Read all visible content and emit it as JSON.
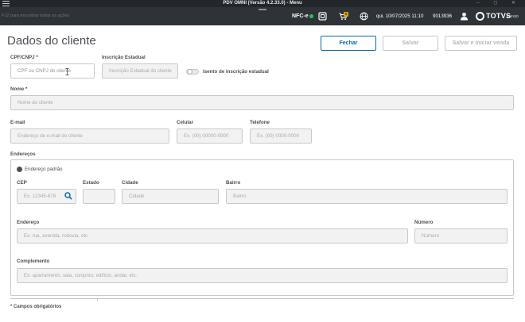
{
  "window": {
    "title": "PDV OMNI (Versão 4.2.33.0) - Menu",
    "controls": "–  ◻  ✕"
  },
  "header": {
    "hint": "F12 para encontrar todas as ações",
    "nfce_label": "NFC-e",
    "cart_badge": "0",
    "datetime": "qui. 10/07/2025 11:10",
    "store_code": "9013936",
    "brand": "TOTVS",
    "brand_sub": "varejo"
  },
  "page": {
    "title": "Dados do cliente"
  },
  "actions": {
    "close": "Fechar",
    "save": "Salvar",
    "save_and_sell": "Salvar e iniciar venda"
  },
  "form": {
    "cpf_label": "CPF/CNPJ *",
    "cpf_placeholder": "CPF ou CNPJ do cliente",
    "ie_label": "Inscrição Estadual",
    "ie_placeholder": "Inscrição Estadual do cliente",
    "ie_exempt_label": "Isento de inscrição estadual",
    "name_label": "Nome *",
    "name_placeholder": "Nome do cliente",
    "email_label": "E-mail",
    "email_placeholder": "Endereço de e-mail do cliente",
    "mobile_label": "Celular",
    "mobile_placeholder": "Ex. (00) 00000-0000",
    "phone_label": "Telefone",
    "phone_placeholder": "Ex. (00) 0000-0000"
  },
  "address": {
    "section_label": "Endereços",
    "default_label": "Endereço padrão",
    "cep_label": "CEP",
    "cep_placeholder": "Ex. 12345-678",
    "state_label": "Estado",
    "city_label": "Cidade",
    "city_placeholder": "Cidade",
    "district_label": "Bairro",
    "district_placeholder": "Bairro",
    "street_label": "Endereço",
    "street_placeholder": "Ex. rua, avenida, rodovia, etc.",
    "number_label": "Número",
    "number_placeholder": "Número",
    "complement_label": "Complemento",
    "complement_placeholder": "Ex. apartamento, sala, conjunto, edifício, andar, etc."
  },
  "footer": {
    "required_note": "* Campos obrigatórios"
  },
  "colors": {
    "primary": "#0b6aa7",
    "header_bg": "#2e3338",
    "titlebar_bg": "#23272b",
    "nfce_status": "#22c55e",
    "cart_badge": "#d9a400"
  }
}
